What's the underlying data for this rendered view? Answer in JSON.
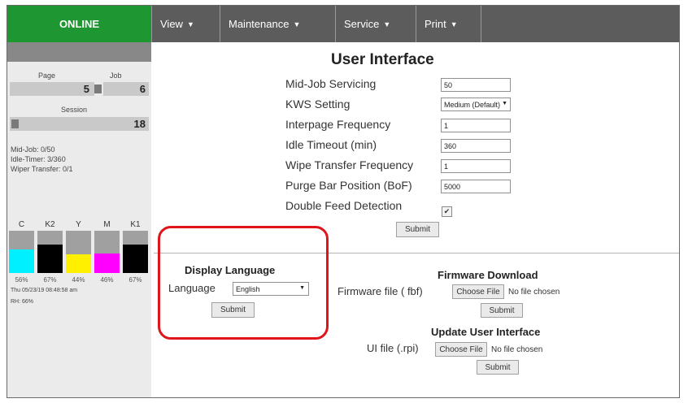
{
  "nav": {
    "status": "ONLINE",
    "menus": [
      {
        "label": "View"
      },
      {
        "label": "Maintenance"
      },
      {
        "label": "Service"
      },
      {
        "label": "Print"
      }
    ]
  },
  "status_panel": {
    "page_label": "Page",
    "job_label": "Job",
    "page_value": "5",
    "job_value": "6",
    "session_label": "Session",
    "session_value": "18",
    "mid_job": "Mid-Job: 0/50",
    "idle_timer": "Idle-Timer: 3/360",
    "wiper_transfer": "Wiper Transfer: 0/1",
    "inks": [
      {
        "name": "C",
        "percent": "56%",
        "level": 0.56,
        "color": "#00f0ff"
      },
      {
        "name": "K2",
        "percent": "67%",
        "level": 0.67,
        "color": "#000000"
      },
      {
        "name": "Y",
        "percent": "44%",
        "level": 0.44,
        "color": "#fff000"
      },
      {
        "name": "M",
        "percent": "46%",
        "level": 0.46,
        "color": "#ff00ff"
      },
      {
        "name": "K1",
        "percent": "67%",
        "level": 0.67,
        "color": "#000000"
      }
    ],
    "timestamp": "Thu 05/23/19 08:48:58 am",
    "rh": "RH: 66%"
  },
  "user_interface": {
    "title": "User Interface",
    "fields": {
      "mid_job_servicing": {
        "label": "Mid-Job Servicing",
        "value": "50"
      },
      "kws_setting": {
        "label": "KWS Setting",
        "value": "Medium (Default)"
      },
      "interpage_frequency": {
        "label": "Interpage Frequency",
        "value": "1"
      },
      "idle_timeout": {
        "label": "Idle Timeout (min)",
        "value": "360"
      },
      "wipe_transfer_frequency": {
        "label": "Wipe Transfer Frequency",
        "value": "1"
      },
      "purge_bar_position": {
        "label": "Purge Bar Position (BoF)",
        "value": "5000"
      },
      "double_feed_detection": {
        "label": "Double Feed Detection",
        "checked": true
      }
    },
    "submit": "Submit"
  },
  "display_language": {
    "title": "Display Language",
    "label": "Language",
    "value": "English",
    "submit": "Submit"
  },
  "firmware_download": {
    "title": "Firmware Download",
    "label": "Firmware file ( fbf)",
    "choose": "Choose File",
    "no_file": "No file chosen",
    "submit": "Submit"
  },
  "update_ui": {
    "title": "Update User Interface",
    "label": "UI file (.rpi)",
    "choose": "Choose File",
    "no_file": "No file chosen",
    "submit": "Submit"
  },
  "colors": {
    "online": "#1e9631",
    "nav": "#5c5c5c",
    "highlight": "#e0151b"
  }
}
